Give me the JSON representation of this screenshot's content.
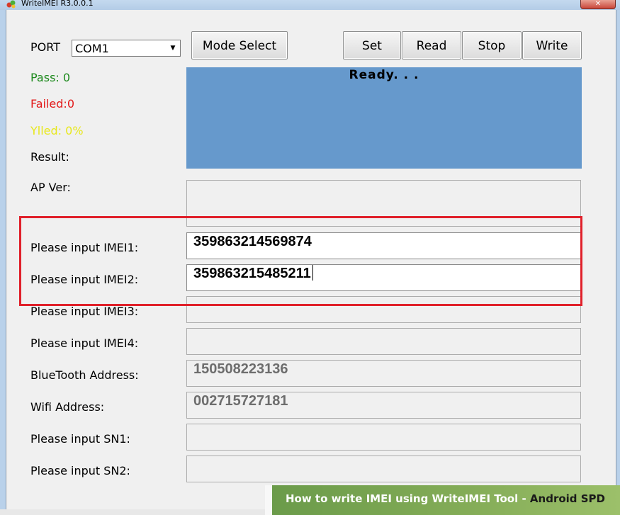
{
  "window": {
    "title": "WriteIMEI R3.0.0.1",
    "close_label": "✕"
  },
  "port": {
    "label": "PORT",
    "value": "COM1"
  },
  "buttons": {
    "mode_select": "Mode Select",
    "set": "Set",
    "read": "Read",
    "stop": "Stop",
    "write": "Write"
  },
  "stats": {
    "pass": "Pass:  0",
    "failed": "Failed:0",
    "yield": "Ylled: 0%",
    "result": "Result:",
    "colors": {
      "pass": "#1e8a1e",
      "failed": "#e21a1a",
      "yield": "#e8e81c"
    }
  },
  "status": {
    "text": "Ready. . ."
  },
  "fields": {
    "ap_ver": {
      "label": "AP Ver:",
      "value": ""
    },
    "imei1": {
      "label": "Please input IMEI1:",
      "value": "359863214569874"
    },
    "imei2": {
      "label": "Please input IMEI2:",
      "value": "359863215485211"
    },
    "imei3": {
      "label": "Please input IMEI3:",
      "value": ""
    },
    "imei4": {
      "label": "Please input IMEI4:",
      "value": ""
    },
    "bluetooth": {
      "label": "BlueTooth Address:",
      "value": "150508223136"
    },
    "wifi": {
      "label": "Wifi Address:",
      "value": "002715727181"
    },
    "sn1": {
      "label": "Please input SN1:",
      "value": ""
    },
    "sn2": {
      "label": "Please input SN2:",
      "value": ""
    }
  },
  "banner": {
    "text": "How to write IMEI using WriteIMEI Tool - ",
    "text_bold": "Android SPD"
  },
  "accent": {
    "highlight": "#e0202a",
    "status_bg": "#6699cc"
  }
}
